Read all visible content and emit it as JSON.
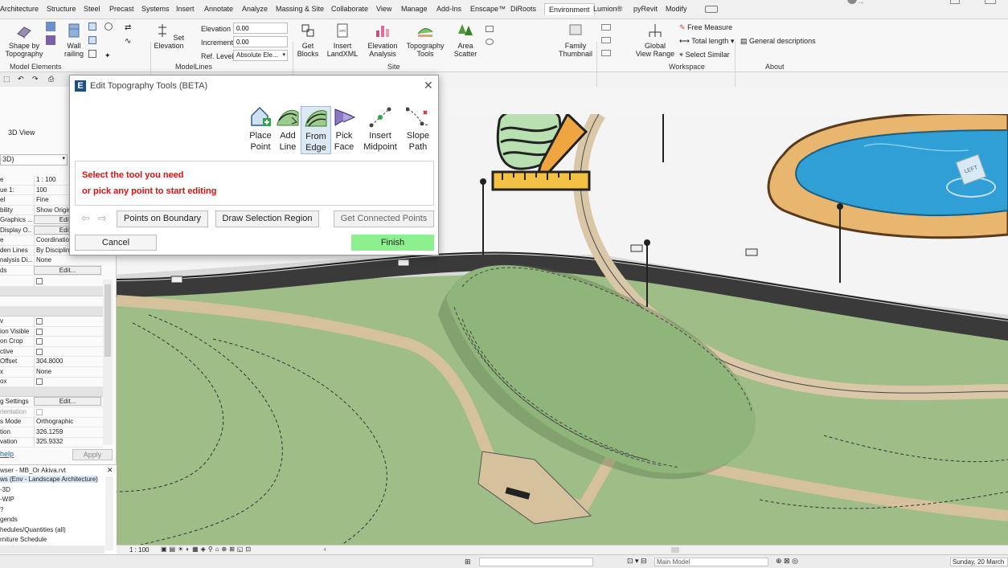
{
  "ribbon": {
    "tabs": [
      "Architecture",
      "Structure",
      "Steel",
      "Precast",
      "Systems",
      "Insert",
      "Annotate",
      "Analyze",
      "Massing & Site",
      "Collaborate",
      "View",
      "Manage",
      "Add-Ins",
      "Enscape™",
      "DiRoots",
      "Environment",
      "Lumion®",
      "pyRevit",
      "Modify"
    ],
    "active_tab": "Environment",
    "user": "...",
    "buttons": {
      "shape_by_topography": "Shape by\nTopography",
      "wall_railing": "Wall\nrailing",
      "set_elevation": "Set\nElevation",
      "get_blocks": "Get\nBlocks",
      "insert_landxml": "Insert\nLandXML",
      "elevation_analysis": "Elevation\nAnalysis",
      "topography_tools": "Topography\nTools",
      "area_scatter": "Area\nScatter",
      "family_thumbnail": "Family\nThumbnail",
      "global_view_range": "Global\nView Range",
      "free_measure": "Free Measure",
      "total_length": "Total length",
      "select_similar": "Select Similar",
      "general_descriptions": "General descriptions"
    },
    "fields": {
      "elevation_label": "Elevation",
      "elevation_value": "0.00",
      "increment_label": "Increment",
      "increment_value": "0.00",
      "ref_level_label": "Ref. Level",
      "ref_level_value": "Absolute Ele..."
    },
    "groups": {
      "model_elements": "Model Elements",
      "modellines": "ModelLines",
      "site": "Site",
      "workspace": "Workspace",
      "about": "About"
    }
  },
  "dialog": {
    "title": "Edit Topography Tools (BETA)",
    "tools": [
      {
        "l1": "Place",
        "l2": "Point"
      },
      {
        "l1": "Add",
        "l2": "Line"
      },
      {
        "l1": "From",
        "l2": "Edge"
      },
      {
        "l1": "Pick",
        "l2": "Face"
      },
      {
        "l1": "Insert",
        "l2": "Midpoint"
      },
      {
        "l1": "Slope",
        "l2": "Path"
      }
    ],
    "message_line1": "Select the tool you need",
    "message_line2": "or pick any point to start editing",
    "points_on_boundary": "Points on Boundary",
    "draw_selection_region": "Draw Selection Region",
    "get_connected_points": "Get Connected Points",
    "cancel": "Cancel",
    "finish": "Finish"
  },
  "properties": {
    "view_name": "3D View",
    "dropdown": "3D)",
    "rows": [
      {
        "k": "e",
        "v": "1 : 100"
      },
      {
        "k": "ue    1:",
        "v": "100"
      },
      {
        "k": "el",
        "v": "Fine"
      },
      {
        "k": "bility",
        "v": "Show Origin..."
      },
      {
        "k": "Graphics ...",
        "v": "Edit..."
      },
      {
        "k": "Display O...",
        "v": "Edit..."
      },
      {
        "k": "e",
        "v": "Coordinatio..."
      },
      {
        "k": "den Lines",
        "v": "By Discipline"
      },
      {
        "k": "nalysis Di...",
        "v": "None"
      },
      {
        "k": "ds",
        "v": "Edit..."
      }
    ],
    "rows2": [
      {
        "k": "v"
      },
      {
        "k": "ion Visible"
      },
      {
        "k": "on Crop"
      },
      {
        "k": "ctive"
      }
    ],
    "offset_k": "Offset",
    "offset_v": "304.8000",
    "x_k": "x",
    "x_v": "None",
    "ox_k": "ox",
    "settings_k": "g Settings",
    "settings_v": "Edit...",
    "orientation_k": "rientation",
    "mode_k": "s Mode",
    "mode_v": "Orthographic",
    "tion_k": "tion",
    "tion_v": "326.1259",
    "elevation_k": "vation",
    "elevation_v": "325.9332",
    "help": "help",
    "apply": "Apply"
  },
  "browser": {
    "title": "wser - MB_Or Akiva.rvt",
    "items": [
      "ws (Env - Landscape Architecture)",
      "-3D",
      "-WIP",
      "?",
      "gends",
      "hedules/Quantities (all)",
      "rniture Schedule"
    ]
  },
  "viewcube": {
    "face": "LEFT"
  },
  "view_status": {
    "scale": "1 : 100"
  },
  "status_bar": {
    "model": "Main Model",
    "date": "Sunday, 20 March"
  }
}
